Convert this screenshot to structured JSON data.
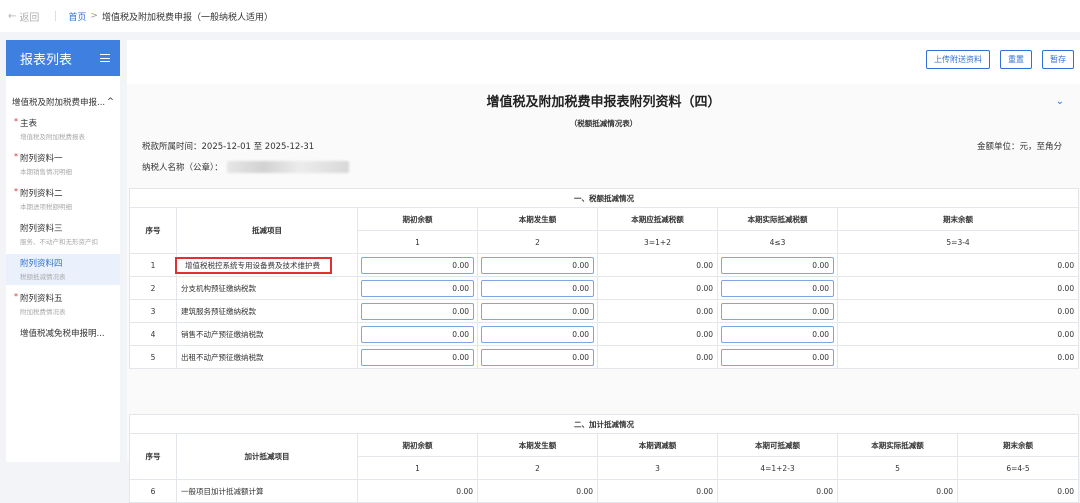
{
  "topbar": {
    "back_label": "返回",
    "crumb_home": "首页",
    "crumb_arrow": ">",
    "crumb_current": "增值税及附加税费申报（一般纳税人适用）"
  },
  "sidebar": {
    "title": "报表列表",
    "group_label": "增值税及附加税费申报...",
    "items": [
      {
        "name": "主表",
        "sub": "增值税及附加税费报表",
        "required": true
      },
      {
        "name": "附列资料一",
        "sub": "本期销售情况明细",
        "required": true
      },
      {
        "name": "附列资料二",
        "sub": "本期进项税额明细",
        "required": true
      },
      {
        "name": "附列资料三",
        "sub": "服务、不动产和无形资产扣",
        "required": false
      },
      {
        "name": "附列资料四",
        "sub": "税额抵减情况表",
        "required": false
      },
      {
        "name": "附列资料五",
        "sub": "附加税费情况表",
        "required": true
      }
    ],
    "last_item": "增值税减免税申报明...",
    "star": "*"
  },
  "actions": {
    "upload": "上传附送资料",
    "reset": "重置",
    "save": "暂存"
  },
  "form": {
    "title": "增值税及附加税费申报表附列资料（四）",
    "subtitle": "（税额抵减情况表）",
    "period_label": "税款所属时间：2025-12-01 至 2025-12-31",
    "unit_label": "金额单位：元，至角分",
    "taxpayer_label": "纳税人名称（公章）："
  },
  "section1": {
    "title": "一、税额抵减情况",
    "col_seq": "序号",
    "col_item": "抵减项目",
    "cols": [
      "期初余额",
      "本期发生额",
      "本期应抵减税额",
      "本期实际抵减税额",
      "期末余额"
    ],
    "col_nums": [
      "1",
      "2",
      "3=1+2",
      "4≤3",
      "5=3-4"
    ],
    "rows": [
      {
        "seq": "1",
        "item": "增值税税控系统专用设备费及技术维护费",
        "v1": "0.00",
        "v2": "0.00",
        "v3": "0.00",
        "v4": "0.00",
        "v5": "0.00"
      },
      {
        "seq": "2",
        "item": "分支机构预征缴纳税款",
        "v1": "0.00",
        "v2": "0.00",
        "v3": "0.00",
        "v4": "0.00",
        "v5": "0.00"
      },
      {
        "seq": "3",
        "item": "建筑服务预征缴纳税款",
        "v1": "0.00",
        "v2": "0.00",
        "v3": "0.00",
        "v4": "0.00",
        "v5": "0.00"
      },
      {
        "seq": "4",
        "item": "销售不动产预征缴纳税款",
        "v1": "0.00",
        "v2": "0.00",
        "v3": "0.00",
        "v4": "0.00",
        "v5": "0.00"
      },
      {
        "seq": "5",
        "item": "出租不动产预征缴纳税款",
        "v1": "0.00",
        "v2": "0.00",
        "v3": "0.00",
        "v4": "0.00",
        "v5": "0.00"
      }
    ]
  },
  "section2": {
    "title": "二、加计抵减情况",
    "col_seq": "序号",
    "col_item": "加计抵减项目",
    "cols": [
      "期初余额",
      "本期发生额",
      "本期调减额",
      "本期可抵减额",
      "本期实际抵减额",
      "期末余额"
    ],
    "col_nums": [
      "1",
      "2",
      "3",
      "4=1+2-3",
      "5",
      "6=4-5"
    ],
    "rows": [
      {
        "seq": "6",
        "item": "一般项目加计抵减额计算",
        "v1": "0.00",
        "v2": "0.00",
        "v3": "0.00",
        "v4": "0.00",
        "v5": "0.00",
        "v6": "0.00"
      }
    ]
  }
}
